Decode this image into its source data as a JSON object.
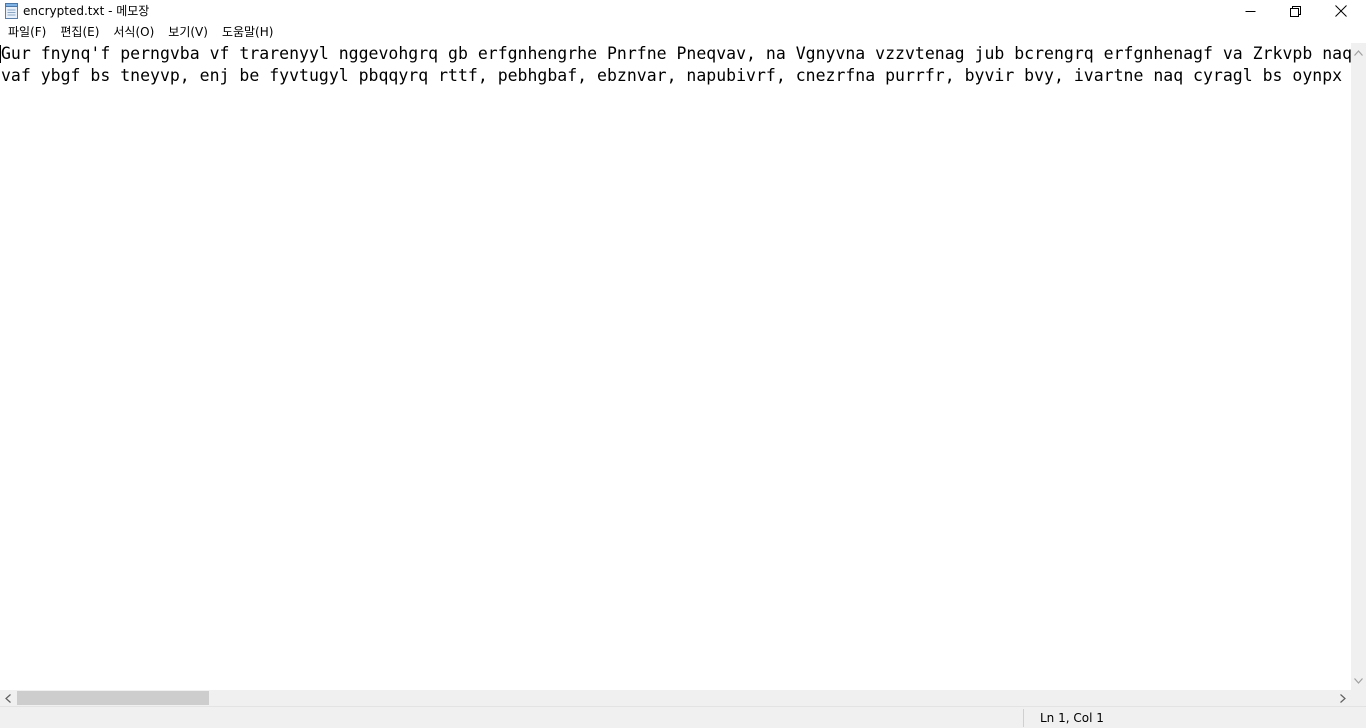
{
  "window": {
    "title": "encrypted.txt - 메모장",
    "icons": {
      "app": "notepad-icon",
      "minimize": "minimize-icon",
      "maximize": "restore-icon",
      "close": "close-icon"
    }
  },
  "menu": {
    "items": [
      {
        "label": "파일(F)"
      },
      {
        "label": "편집(E)"
      },
      {
        "label": "서식(O)"
      },
      {
        "label": "보기(V)"
      },
      {
        "label": "도움말(H)"
      }
    ]
  },
  "editor": {
    "lines": [
      "Gur fnynq'f perngvba vf trarenyyl nggevohgrq gb erfgnhengrhe Pnrfne Pneqvav, na Vgnyvna vzzvtenag jub bcrengrq erfgnhenagf va Zrkvpb naq gur Havgrq Fg",
      "vaf ybgf bs tneyvp, enj be fyvtugyl pbqqyrq rttf, pebhgbaf, ebznvar, napubivrf, cnezrfna purrfr, byvir bvy, ivartne naq cyragl bs oynpx crccre."
    ]
  },
  "scrollbars": {
    "horizontal_position": 0.0
  },
  "status": {
    "position": "Ln 1, Col 1"
  },
  "colors": {
    "chrome": "#f0f0f0",
    "thumb": "#cdcdcd",
    "background": "#ffffff"
  }
}
